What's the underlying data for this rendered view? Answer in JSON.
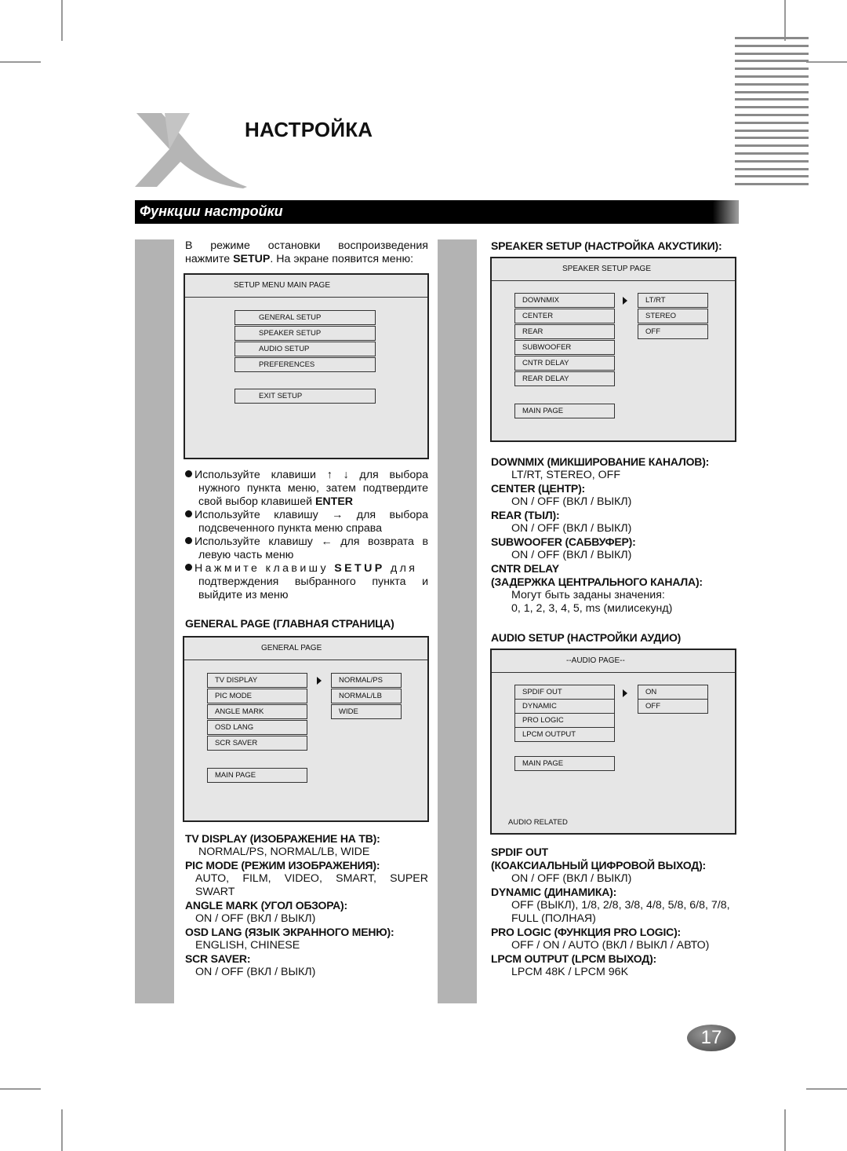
{
  "page": {
    "title": "НАСТРОЙКА",
    "section_banner": "Функции настройки",
    "page_number": "17",
    "logo_icon": "x-logo-icon"
  },
  "left": {
    "intro_line1": "В режиме остановки воспроизведения",
    "intro_line2_pre": "нажмите ",
    "intro_line2_bold": "SETUP",
    "intro_line2_post": ". На экране появится меню:",
    "setup_menu": {
      "title": "SETUP MENU   MAIN PAGE",
      "items": [
        "GENERAL SETUP",
        "SPEAKER SETUP",
        "AUDIO SETUP",
        "PREFERENCES"
      ],
      "exit": "EXIT SETUP"
    },
    "bullets": [
      {
        "lines": [
          "Используйте клавиши ↑ ↓ для выбора",
          "нужного пункта меню, затем подтвердите"
        ],
        "last_pre": "свой выбор клавишей ",
        "last_bold": "ENTER"
      },
      {
        "lines": [
          "Используйте клавишу → для выбора",
          "подсвеченного пункта меню справа"
        ]
      },
      {
        "lines": [
          "Используйте клавишу ← для возврата в",
          "левую часть меню"
        ]
      },
      {
        "first_pre": "Нажмите клавишу ",
        "first_bold": "SETUP",
        "first_post": " для",
        "lines": [
          "подтверждения выбранного пункта и",
          "выйдите из меню"
        ]
      }
    ],
    "general_heading": "GENERAL PAGE (ГЛАВНАЯ СТРАНИЦА)",
    "general_menu": {
      "title": "GENERAL PAGE",
      "items": [
        "TV DISPLAY",
        "PIC MODE",
        "ANGLE MARK",
        "OSD LANG",
        "SCR SAVER"
      ],
      "options": [
        "NORMAL/PS",
        "NORMAL/LB",
        "WIDE"
      ],
      "main_page": "MAIN PAGE"
    },
    "descriptions": [
      {
        "heading": "TV DISPLAY (ИЗОБРАЖЕНИЕ НА ТВ):",
        "value": "NORMAL/PS, NORMAL/LB, WIDE"
      },
      {
        "heading": "PIC MODE (РЕЖИМ ИЗОБРАЖЕНИЯ):",
        "value": "AUTO, FILM, VIDEO, SMART, SUPER",
        "value2": "SWART"
      },
      {
        "heading": "ANGLE MARK (УГОЛ ОБЗОРА):",
        "value": "ON / OFF (ВКЛ / ВЫКЛ)"
      },
      {
        "heading": "OSD LANG (ЯЗЫК ЭКРАННОГО МЕНЮ):",
        "value": "ENGLISH, CHINESE"
      },
      {
        "heading": "SCR SAVER:",
        "value": "ON / OFF (ВКЛ / ВЫКЛ)"
      }
    ]
  },
  "right": {
    "speaker_heading": "SPEAKER SETUP (НАСТРОЙКА АКУСТИКИ):",
    "speaker_menu": {
      "title": "SPEAKER SETUP PAGE",
      "items": [
        "DOWNMIX",
        "CENTER",
        "REAR",
        "SUBWOOFER",
        "CNTR DELAY",
        "REAR DELAY"
      ],
      "options": [
        "LT/RT",
        "STEREO",
        "OFF"
      ],
      "main_page": "MAIN PAGE"
    },
    "speaker_desc": [
      {
        "heading": "DOWNMIX (МИКШИРОВАНИЕ КАНАЛОВ):",
        "value": "LT/RT, STEREO, OFF"
      },
      {
        "heading": "CENTER (ЦЕНТР):",
        "value": "ON / OFF (ВКЛ / ВЫКЛ)"
      },
      {
        "heading": "REAR (ТЫЛ):",
        "value": "ON / OFF (ВКЛ / ВЫКЛ)"
      },
      {
        "heading": "SUBWOOFER (САБВУФЕР):",
        "value": "ON / OFF (ВКЛ / ВЫКЛ)"
      },
      {
        "heading": "CNTR DELAY",
        "heading2": "(ЗАДЕРЖКА ЦЕНТРАЛЬНОГО  КАНАЛА):",
        "value": "Могут быть заданы значения:",
        "value2": "0, 1, 2, 3, 4, 5, ms (милисекунд)"
      }
    ],
    "audio_heading": "AUDIO SETUP (НАСТРОЙКИ АУДИО)",
    "audio_menu": {
      "title": "--AUDIO PAGE--",
      "items": [
        "SPDIF OUT",
        "DYNAMIC",
        "PRO LOGIC",
        "LPCM OUTPUT"
      ],
      "options": [
        "ON",
        "OFF"
      ],
      "main_page": "MAIN PAGE",
      "footer": "AUDIO RELATED"
    },
    "audio_desc": [
      {
        "heading": "SPDIF OUT",
        "heading2": "(КОАКСИАЛЬНЫЙ ЦИФРОВОЙ ВЫХОД):",
        "value": "ON / OFF (ВКЛ / ВЫКЛ)"
      },
      {
        "heading": "DYNAMIC (ДИНАМИКА):",
        "value": "OFF (ВЫКЛ), 1/8, 2/8, 3/8, 4/8, 5/8, 6/8, 7/8,",
        "value2": "FULL (ПОЛНАЯ)"
      },
      {
        "heading": "PRO LOGIC (ФУНКЦИЯ PRO LOGIC):",
        "value": "OFF / ON /  AUTO (ВКЛ / ВЫКЛ / АВТО)"
      },
      {
        "heading": "LPCM OUTPUT (LPCM ВЫХОД):",
        "value": "LPCM 48K / LPCM 96K"
      }
    ]
  }
}
